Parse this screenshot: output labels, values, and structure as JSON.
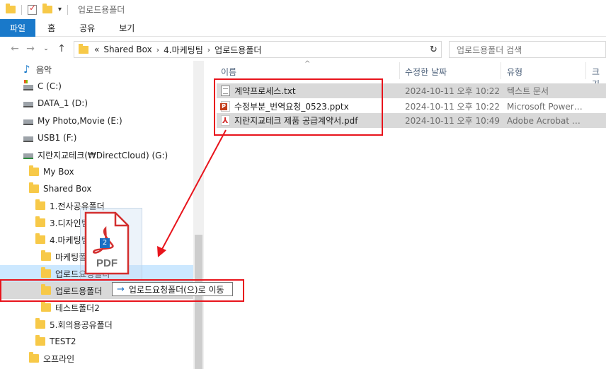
{
  "window": {
    "title": "업로드용폴더"
  },
  "ribbon": {
    "tabs": [
      "파일",
      "홈",
      "공유",
      "보기"
    ]
  },
  "address": {
    "path": [
      "Shared Box",
      "4.마케팅팀",
      "업로드용폴더"
    ],
    "overflow": "«",
    "search_placeholder": "업로드용폴더 검색"
  },
  "nav": {
    "items": [
      {
        "label": "음악",
        "icon": "music-icon"
      },
      {
        "label": "C (C:)",
        "icon": "system-drive-icon"
      },
      {
        "label": "DATA_1 (D:)",
        "icon": "drive-icon"
      },
      {
        "label": "My Photo,Movie (E:)",
        "icon": "drive-icon"
      },
      {
        "label": "USB1 (F:)",
        "icon": "drive-icon"
      },
      {
        "label": "지란지교테크(₩DirectCloud) (G:)",
        "icon": "network-drive-icon"
      },
      {
        "label": "My Box",
        "icon": "folder-icon"
      },
      {
        "label": "Shared Box",
        "icon": "folder-icon"
      },
      {
        "label": "1.전사공유폴더",
        "icon": "folder-icon"
      },
      {
        "label": "3.디자인팀",
        "icon": "folder-icon"
      },
      {
        "label": "4.마케팅팀",
        "icon": "folder-icon"
      },
      {
        "label": "마케팅폴더",
        "icon": "folder-icon"
      },
      {
        "label": "업로드요청폴더",
        "icon": "folder-icon"
      },
      {
        "label": "업로드용폴더",
        "icon": "folder-icon"
      },
      {
        "label": "테스트폴더2",
        "icon": "folder-icon"
      },
      {
        "label": "5.회의용공유폴더",
        "icon": "folder-icon"
      },
      {
        "label": "TEST2",
        "icon": "folder-icon"
      },
      {
        "label": "오프라인",
        "icon": "folder-icon"
      }
    ]
  },
  "columns": {
    "name": "이름",
    "modified": "수정한 날짜",
    "type": "유형",
    "size": "크기"
  },
  "files": [
    {
      "name": "계약프로세스.txt",
      "modified": "2024-10-11 오후 10:22",
      "type": "텍스트 문서",
      "icon": "text-file-icon"
    },
    {
      "name": "수정부분_번역요청_0523.pptx",
      "modified": "2024-10-11 오후 10:22",
      "type": "Microsoft PowerP...",
      "icon": "powerpoint-file-icon"
    },
    {
      "name": "지란지교테크 제품 공급계약서.pdf",
      "modified": "2024-10-11 오후 10:49",
      "type": "Adobe Acrobat D...",
      "icon": "pdf-file-icon"
    }
  ],
  "drag": {
    "count": "2",
    "label": "PDF",
    "tooltip": "업로드요청폴더(으)로 이동"
  },
  "colors": {
    "accent": "#1979ca",
    "annotation": "#e8141c",
    "selection": "#cce8ff"
  }
}
